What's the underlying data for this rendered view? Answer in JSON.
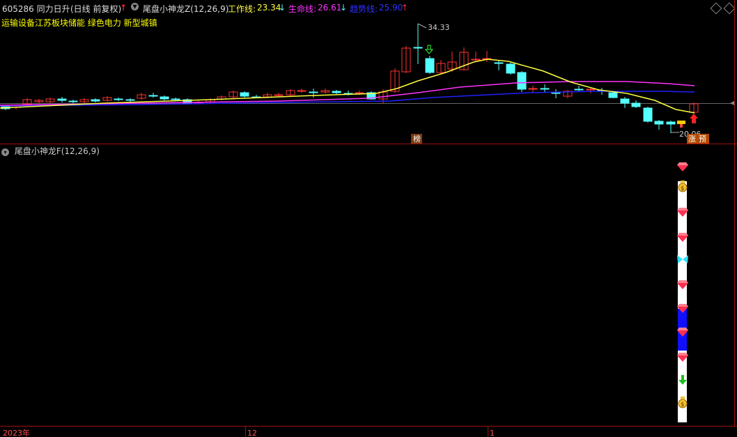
{
  "header": {
    "code_name": "605286 同力日升",
    "period": "(日线 前复权)",
    "indicator_name": "尾盘小神龙Z(12,26,9)",
    "work_line_label": "工作线:",
    "work_line_value": "23.34",
    "life_line_label": "生命线:",
    "life_line_value": "26.61",
    "trend_line_label": "趋势线:",
    "trend_line_value": "25.90"
  },
  "sectors": "运输设备江苏板块储能 绿色电力 新型城镇",
  "price_labels": {
    "high": "34.33",
    "low": "20.06",
    "bang": "榜",
    "zhang": "涨",
    "yu": "预"
  },
  "sub_indicator": {
    "title": "尾盘小神龙F(12,26,9)"
  },
  "time_axis": {
    "year": "2023年",
    "dec": "12",
    "jan": "1"
  },
  "icons": {
    "up_arrow": "red-up-arrow-icon",
    "down_arrow": "down-arrow-icon",
    "diamond": "red-diamond-icon",
    "money_bag": "money-bag-icon",
    "butterfly": "butterfly-icon"
  },
  "colors": {
    "up": "#ff3333",
    "down": "#54ffff",
    "work_line": "#ffff40",
    "life_line": "#ff33ff",
    "trend_line": "#2020ff"
  }
}
